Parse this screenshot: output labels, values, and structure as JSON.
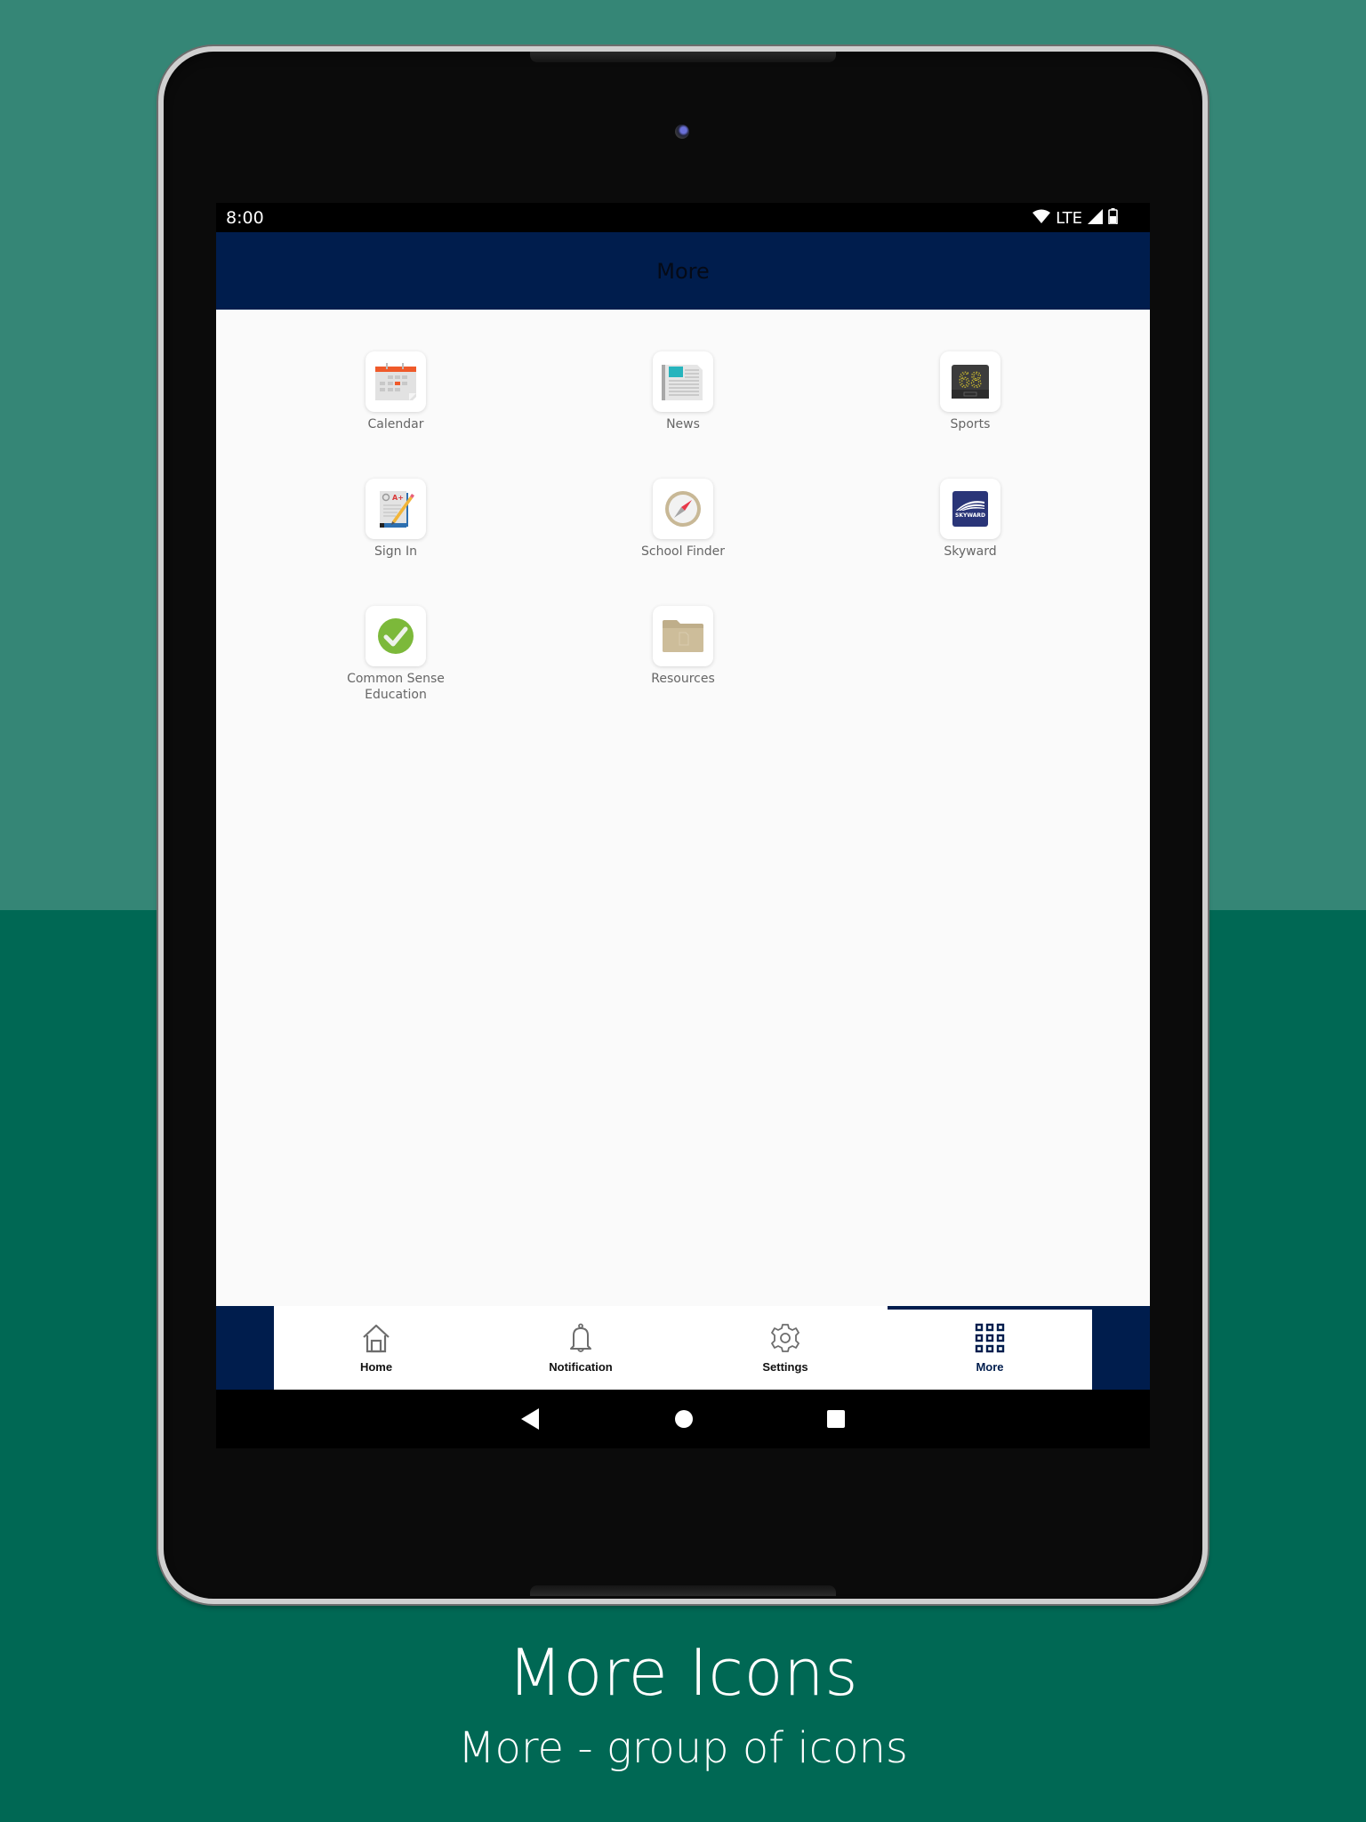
{
  "status_bar": {
    "time": "8:00",
    "network": "LTE",
    "icons": [
      "wifi-icon",
      "signal-icon",
      "battery-icon"
    ]
  },
  "header": {
    "title": "More"
  },
  "tiles": [
    {
      "label": "Calendar",
      "icon": "calendar-icon"
    },
    {
      "label": "News",
      "icon": "newspaper-icon"
    },
    {
      "label": "Sports",
      "icon": "scoreboard-icon",
      "scoreboard_text": "68"
    },
    {
      "label": "Sign In",
      "icon": "notebook-pencil-icon",
      "grade_text": "A+"
    },
    {
      "label": "School Finder",
      "icon": "compass-icon"
    },
    {
      "label": "Skyward",
      "icon": "skyward-logo-icon",
      "logo_text": "SKYWARD"
    },
    {
      "label": "Common Sense Education",
      "icon": "checkmark-icon"
    },
    {
      "label": "Resources",
      "icon": "folder-icon"
    }
  ],
  "bottom_nav": {
    "tabs": [
      {
        "label": "Home",
        "icon": "home-icon",
        "active": false
      },
      {
        "label": "Notification",
        "icon": "bell-icon",
        "active": false
      },
      {
        "label": "Settings",
        "icon": "gear-icon",
        "active": false
      },
      {
        "label": "More",
        "icon": "grid-icon",
        "active": true
      }
    ]
  },
  "system_nav": {
    "buttons": [
      "back-icon",
      "home-circle-icon",
      "recents-icon"
    ]
  },
  "caption": {
    "title": "More Icons",
    "subtitle": "More - group of icons"
  },
  "colors": {
    "brand_navy": "#001d4d",
    "bg_top": "#358676",
    "bg_bottom": "#006854"
  }
}
